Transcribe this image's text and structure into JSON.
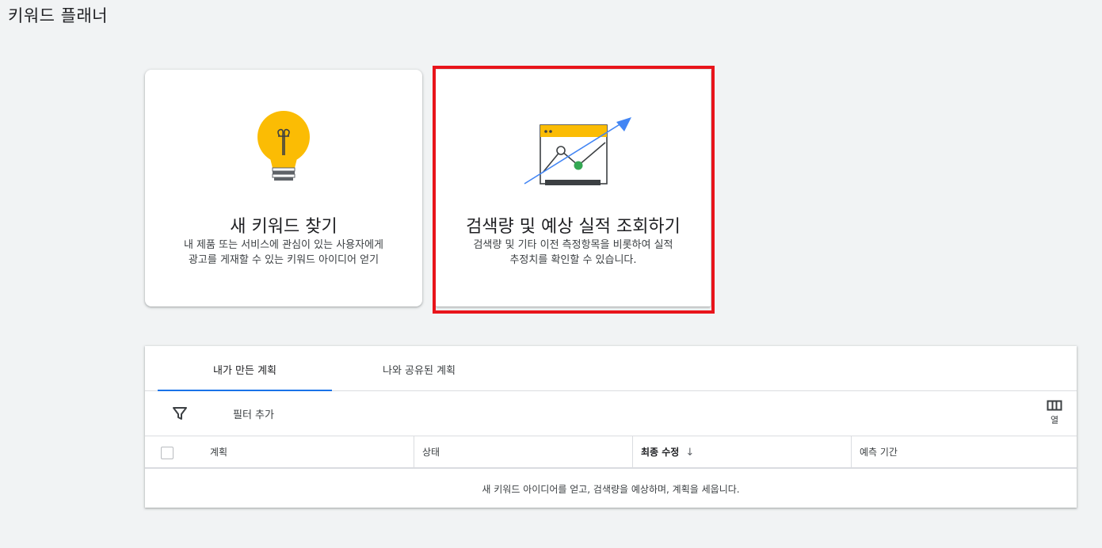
{
  "page_title": "키워드 플래너",
  "cards": {
    "discover": {
      "title": "새 키워드 찾기",
      "desc_line1": "내 제품 또는 서비스에 관심이 있는 사용자에게",
      "desc_line2": "광고를 게재할 수 있는 키워드 아이디어 얻기",
      "icon": "lightbulb-icon"
    },
    "forecast": {
      "title": "검색량 및 예상 실적 조회하기",
      "desc_line1": "검색량 및 기타 이전 측정항목을 비롯하여 실적",
      "desc_line2": "추정치를 확인할 수 있습니다.",
      "icon": "trend-chart-icon",
      "highlight_color": "#e8141b"
    }
  },
  "plans": {
    "tabs": [
      "내가 만든 계획",
      "나와 공유된 계획"
    ],
    "active_tab": 0,
    "filter_label": "필터 추가",
    "columns_label": "열",
    "headers": {
      "plan": "계획",
      "status": "상태",
      "modified": "최종 수정",
      "forecast_period": "예측 기간"
    },
    "sort_arrow": "↓",
    "empty_message": "새 키워드 아이디어를 얻고, 검색량을 예상하며, 계획을 세웁니다."
  },
  "colors": {
    "accent": "#1a73e8",
    "bulb": "#fbbc04",
    "trend_line": "#4285f4",
    "chart_point": "#34a853"
  }
}
